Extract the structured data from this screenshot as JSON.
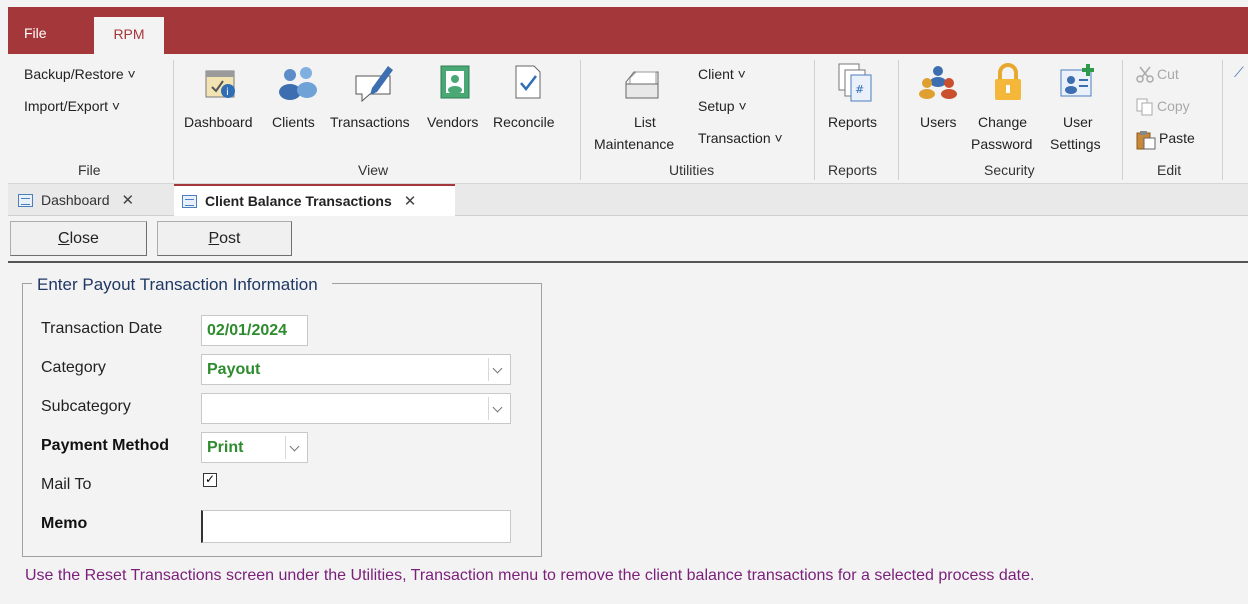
{
  "top_tabs": {
    "file": "File",
    "rpm": "RPM"
  },
  "ribbon": {
    "file_group": {
      "backup_restore": "Backup/Restore ˅",
      "import_export": "Import/Export ˅",
      "label": "File"
    },
    "view_group": {
      "dashboard": "Dashboard",
      "clients": "Clients",
      "transactions": "Transactions",
      "vendors": "Vendors",
      "reconcile": "Reconcile",
      "label": "View"
    },
    "utilities_group": {
      "list_line1": "List",
      "list_line2": "Maintenance",
      "client": "Client ˅",
      "setup": "Setup ˅",
      "transaction": "Transaction ˅",
      "label": "Utilities"
    },
    "reports_group": {
      "reports": "Reports",
      "label": "Reports"
    },
    "security_group": {
      "users": "Users",
      "change_line1": "Change",
      "change_line2": "Password",
      "user_line1": "User",
      "user_line2": "Settings",
      "label": "Security"
    },
    "edit_group": {
      "cut": "Cut",
      "copy": "Copy",
      "paste": "Paste",
      "label": "Edit"
    }
  },
  "doc_tabs": [
    {
      "label": "Dashboard",
      "close": "✕"
    },
    {
      "label": "Client Balance Transactions",
      "close": "✕"
    }
  ],
  "commands": {
    "close_label": "Close",
    "close_accel": "C",
    "close_rest": "lose",
    "post_accel": "P",
    "post_rest": "ost"
  },
  "form": {
    "title": "Enter Payout Transaction Information",
    "transaction_date_label": "Transaction Date",
    "transaction_date_value": "02/01/2024",
    "category_label": "Category",
    "category_value": "Payout",
    "subcategory_label": "Subcategory",
    "subcategory_value": "",
    "payment_method_label": "Payment Method",
    "payment_method_value": "Print",
    "mail_to_label": "Mail To",
    "mail_to_checked": "✓",
    "memo_label": "Memo",
    "memo_value": ""
  },
  "note": "Use the Reset Transactions screen under the Utilities, Transaction menu to remove the client balance transactions for a selected process date.",
  "colors": {
    "brand": "#a4373a",
    "value_green": "#2e8b2e",
    "note_purple": "#7a1f7a",
    "title_navy": "#1f3864"
  }
}
